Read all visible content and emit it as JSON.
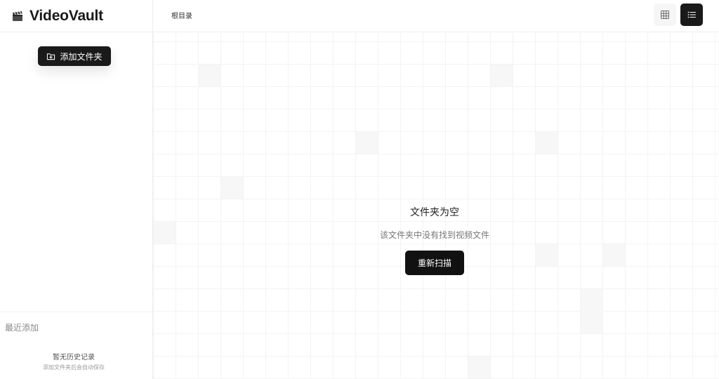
{
  "app": {
    "title": "VideoVault",
    "icon": "clapperboard-icon"
  },
  "sidebar": {
    "add_folder_label": "添加文件夹",
    "add_folder_icon": "folder-plus-icon",
    "recent_title": "最近添加",
    "history_empty": "暂无历史记录",
    "history_hint": "添加文件夹后会自动保存"
  },
  "topbar": {
    "breadcrumb": "根目录",
    "grid_view_icon": "grid-view-icon",
    "list_view_icon": "list-view-icon",
    "active_view": "list"
  },
  "main": {
    "empty_title": "文件夹为空",
    "empty_subtitle": "该文件夹中没有找到视频文件",
    "rescan_label": "重新扫描"
  },
  "colors": {
    "accent": "#1a1a1a",
    "border": "#ececec",
    "grid": "#f3f3f3"
  }
}
